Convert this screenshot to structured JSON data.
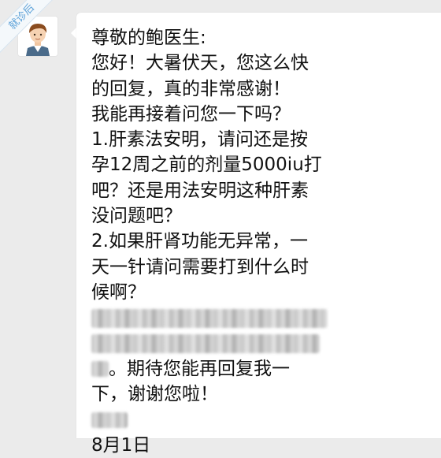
{
  "ribbon": {
    "label": "就诊后"
  },
  "avatar": {
    "icon": "doctor-avatar-icon"
  },
  "message": {
    "lines": [
      "尊敬的鲍医生:",
      "您好！大暑伏天，您这么快",
      "的回复，真的非常感谢！",
      "我能再接着问您一下吗？",
      "1.肝素法安明，请问还是按",
      "孕12周之前的剂量5000iu打",
      "吧？还是用法安明这种肝素",
      "没问题吧？",
      "2.如果肝肾功能无异常，一",
      "天一针请问需要打到什么时",
      "候啊？"
    ],
    "line_after_blur_1": "。期待您能再回复我一",
    "line_after_blur_2": "下，谢谢您啦！",
    "date": "8月1日"
  },
  "colors": {
    "background": "#ebebeb",
    "bubble": "#ffffff",
    "ribbon_text": "#5aa0d8",
    "text": "#111111"
  }
}
